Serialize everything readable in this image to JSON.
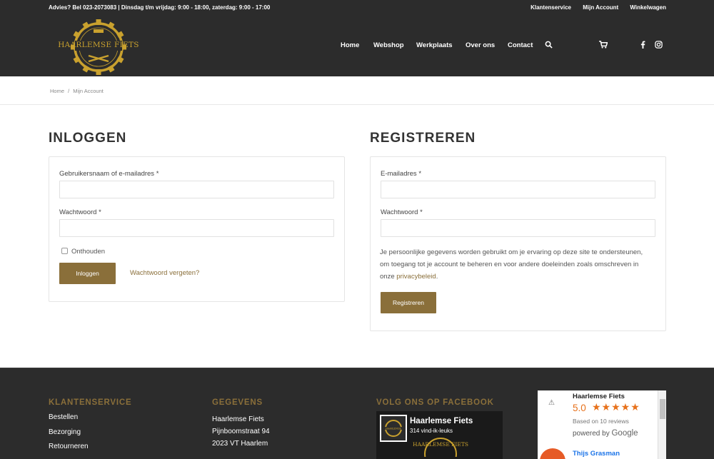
{
  "topbar": {
    "advies": "Advies? Bel 023-2073083 | Dinsdag t/m vrijdag: 9:00 - 18:00, zaterdag: 9:00 - 17:00",
    "links": [
      "Klantenservice",
      "Mijn Account",
      "Winkelwagen"
    ]
  },
  "logo": {
    "text": "HAARLEMSE FIETS",
    "est": "EST. 2016"
  },
  "nav": {
    "items": [
      "Home",
      "Webshop",
      "Werkplaats",
      "Over ons",
      "Contact"
    ],
    "icons": [
      "search-icon",
      "cart-icon",
      "facebook-icon",
      "instagram-icon"
    ]
  },
  "breadcrumb": {
    "home": "Home",
    "separator": "/",
    "current": "Mijn Account"
  },
  "login": {
    "title": "INLOGGEN",
    "username_label": "Gebruikersnaam of e-mailadres *",
    "password_label": "Wachtwoord *",
    "remember_label": "Onthouden",
    "submit_label": "Inloggen",
    "forgot_label": "Wachtwoord vergeten?"
  },
  "register": {
    "title": "REGISTREREN",
    "email_label": "E-mailadres *",
    "password_label": "Wachtwoord *",
    "privacy_before": "Je persoonlijke gegevens worden gebruikt om je ervaring op deze site te ondersteunen, om toegang tot je account te beheren en voor andere doeleinden zoals omschreven in onze ",
    "privacy_link": "privacybeleid",
    "privacy_after": ".",
    "submit_label": "Registreren"
  },
  "footer": {
    "klantenservice": {
      "title": "KLANTENSERVICE",
      "items": [
        "Bestellen",
        "Bezorging",
        "Retourneren"
      ]
    },
    "gegevens": {
      "title": "GEGEVENS",
      "lines": [
        "Haarlemse Fiets",
        "Pijnboomstraat 94",
        "2023 VT Haarlem"
      ]
    },
    "facebook": {
      "title": "VOLG ONS OP FACEBOOK",
      "page_name": "Haarlemse Fiets",
      "likes": "314 vind-ik-leuks"
    },
    "google": {
      "name": "Haarlemse Fiets",
      "rating": "5.0",
      "stars": "★★★★★",
      "based_on": "Based on 10 reviews",
      "powered_by": "powered by",
      "google_word": "Google",
      "reviewer": "Thijs Grasman"
    }
  },
  "colors": {
    "header_bg": "#2c2c2c",
    "accent_gold": "#8a6f3a",
    "logo_gold": "#c9a12e",
    "star_orange": "#e7711b"
  }
}
